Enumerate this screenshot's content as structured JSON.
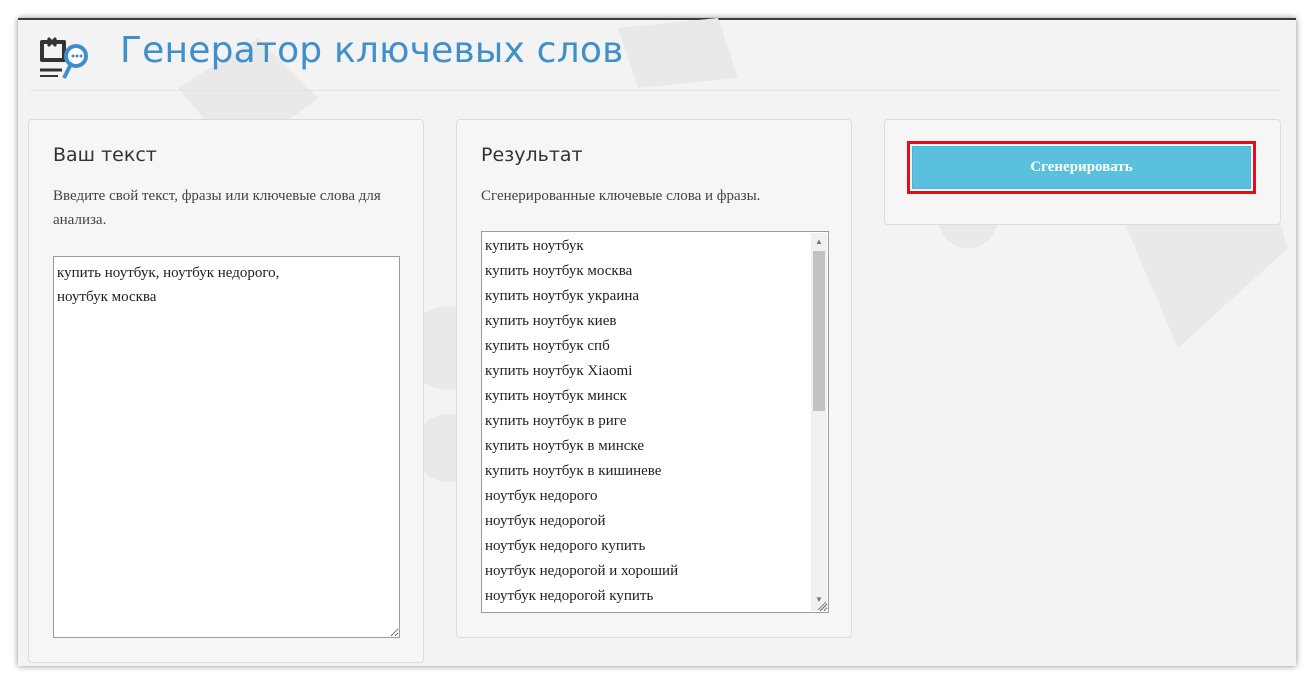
{
  "header": {
    "title": "Генератор ключевых слов"
  },
  "input_panel": {
    "title": "Ваш текст",
    "description": "Введите свой текст, фразы или ключевые слова для анализа.",
    "text_value": "купить ноутбук, ноутбук недорого,\nноутбук москва"
  },
  "result_panel": {
    "title": "Результат",
    "description": "Сгенерированные ключевые слова и фразы.",
    "results": [
      "купить ноутбук",
      "купить ноутбук москва",
      "купить ноутбук украина",
      "купить ноутбук киев",
      "купить ноутбук спб",
      "купить ноутбук Xiaomi",
      "купить ноутбук минск",
      "купить ноутбук в риге",
      "купить ноутбук в минске",
      "купить ноутбук в кишиневе",
      "ноутбук недорого",
      "ноутбук недорогой",
      "ноутбук недорого купить",
      "ноутбук недорогой и хороший",
      "ноутбук недорогой купить"
    ]
  },
  "actions": {
    "generate_label": "Сгенерировать"
  },
  "colors": {
    "title": "#3f8fcb",
    "button": "#5bc0de",
    "highlight_outline": "#e0101a"
  },
  "icons": {
    "logo": "keyword-generator-logo-icon"
  }
}
